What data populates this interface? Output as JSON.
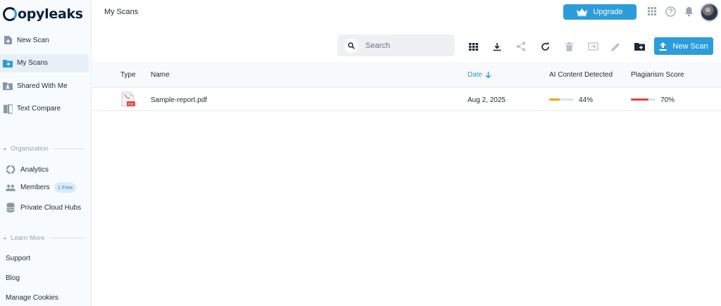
{
  "app": {
    "logo_text": "opyleaks",
    "colors": {
      "accent": "#2d9cdb",
      "ai_bar": "#f0a500",
      "plagiarism_bar": "#e0443a",
      "navy": "#0b1f3a"
    }
  },
  "sidebar": {
    "nav": [
      {
        "label": "New Scan",
        "icon": "new-scan-icon"
      },
      {
        "label": "My Scans",
        "icon": "folder-icon",
        "active": true
      },
      {
        "label": "Shared With Me",
        "icon": "shared-folder-icon"
      },
      {
        "label": "Text Compare",
        "icon": "compare-icon"
      }
    ],
    "organization": {
      "title": "Organization",
      "items": [
        {
          "label": "Analytics",
          "icon": "analytics-icon"
        },
        {
          "label": "Members",
          "icon": "members-icon",
          "badge": "1 Free"
        },
        {
          "label": "Private Cloud Hubs",
          "icon": "database-icon"
        }
      ]
    },
    "learn_more": {
      "title": "Learn More",
      "items": [
        {
          "label": "Support"
        },
        {
          "label": "Blog"
        },
        {
          "label": "Manage Cookies"
        }
      ]
    }
  },
  "header": {
    "title": "My Scans",
    "upgrade_label": "Upgrade",
    "icons": [
      "apps-grid-icon",
      "help-icon",
      "bell-icon",
      "avatar"
    ]
  },
  "toolbar": {
    "search_placeholder": "Search",
    "tools": [
      "grid-view-icon",
      "download-icon",
      "share-icon",
      "refresh-icon",
      "delete-icon",
      "move-icon",
      "edit-icon",
      "new-folder-icon"
    ],
    "new_scan_label": "New Scan"
  },
  "table": {
    "columns": {
      "type": "Type",
      "name": "Name",
      "date": "Date",
      "ai": "AI Content Detected",
      "plagiarism": "Plagiarism Score"
    },
    "sort": {
      "column": "date",
      "direction": "descending"
    },
    "rows": [
      {
        "type_icon": "pdf-file-icon",
        "name": "Sample-report.pdf",
        "date": "Aug 2, 2025",
        "ai_label": "44%",
        "ai_value": 0.44,
        "plagiarism_label": "70%",
        "plagiarism_value": 0.7
      }
    ]
  }
}
